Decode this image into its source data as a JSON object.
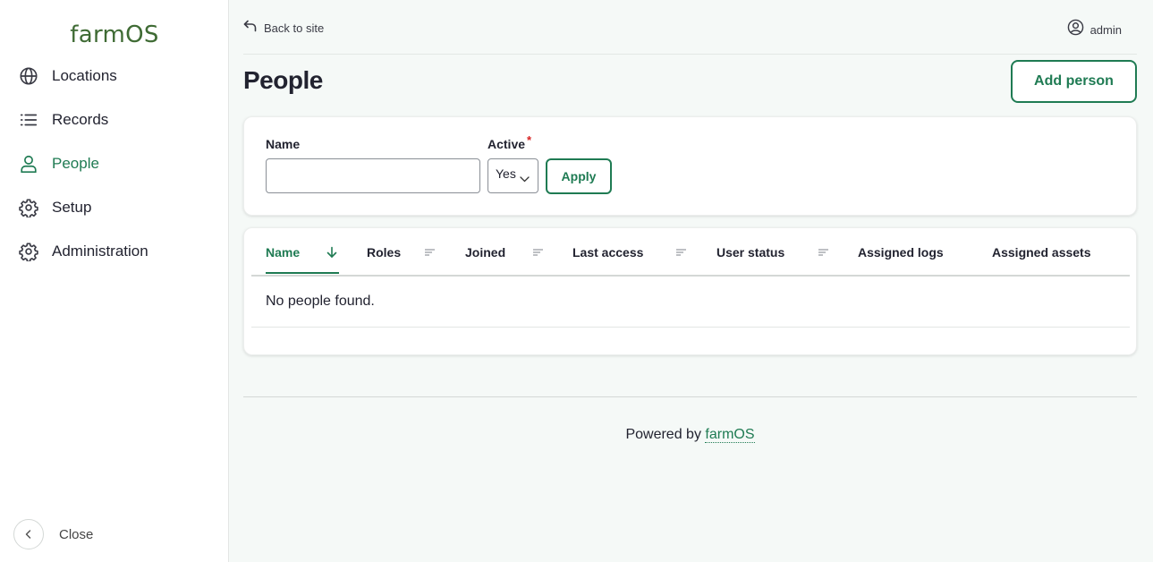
{
  "app": {
    "logo": "farmOS"
  },
  "sidebar": {
    "items": [
      {
        "label": "Locations",
        "icon": "globe-icon",
        "active": false
      },
      {
        "label": "Records",
        "icon": "list-icon",
        "active": false
      },
      {
        "label": "People",
        "icon": "person-icon",
        "active": true
      },
      {
        "label": "Setup",
        "icon": "gear-icon",
        "active": false
      },
      {
        "label": "Administration",
        "icon": "gear-icon",
        "active": false
      }
    ],
    "close_label": "Close"
  },
  "topbar": {
    "back_label": "Back to site",
    "user_label": "admin"
  },
  "page": {
    "title": "People",
    "add_button": "Add person"
  },
  "filters": {
    "name_label": "Name",
    "name_value": "",
    "active_label": "Active",
    "active_required": "*",
    "active_value": "Yes",
    "apply_label": "Apply"
  },
  "table": {
    "columns": [
      {
        "label": "Name",
        "sortable": true,
        "sorted": "desc"
      },
      {
        "label": "Roles",
        "sortable": true
      },
      {
        "label": "Joined",
        "sortable": true
      },
      {
        "label": "Last access",
        "sortable": true
      },
      {
        "label": "User status",
        "sortable": true
      },
      {
        "label": "Assigned logs",
        "sortable": false
      },
      {
        "label": "Assigned assets",
        "sortable": false
      }
    ],
    "empty_message": "No people found."
  },
  "footer": {
    "prefix": "Powered by",
    "link": "farmOS"
  },
  "colors": {
    "accent": "#1f7b53",
    "logo": "#3f6b34",
    "required": "#d72222",
    "background": "#f5f9f7"
  }
}
